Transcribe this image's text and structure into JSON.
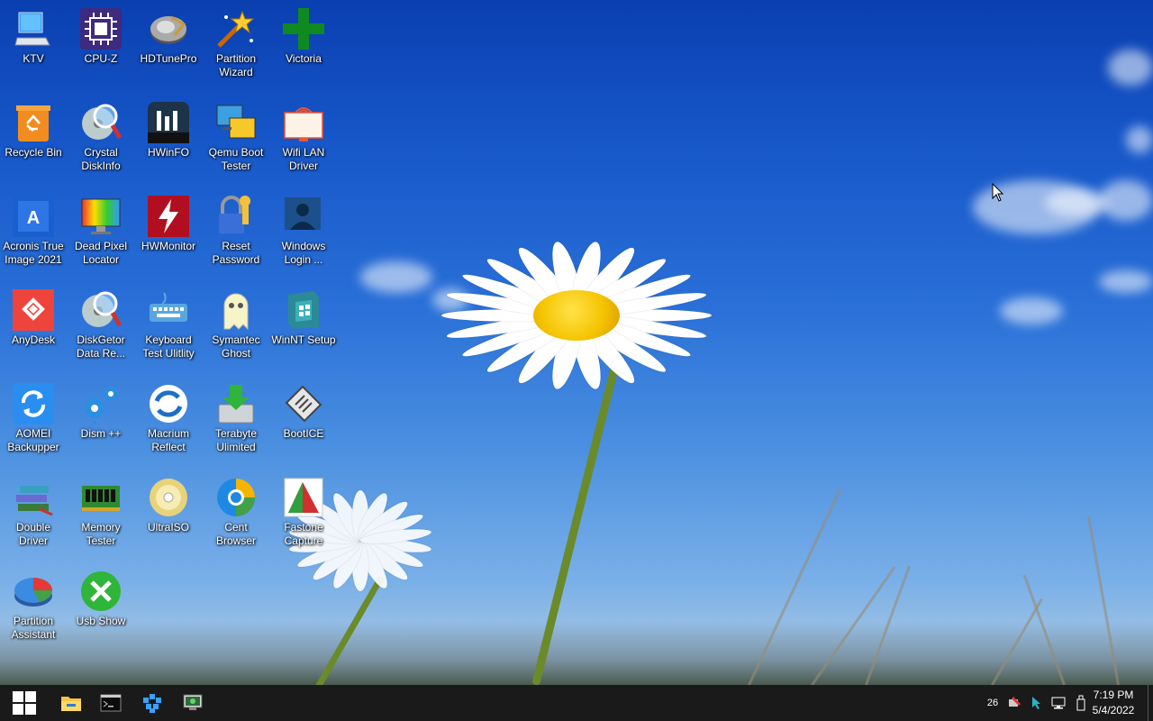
{
  "desktop_icons": [
    {
      "name": "ktv",
      "label": "KTV",
      "icon": "computer-icon"
    },
    {
      "name": "cpu-z",
      "label": "CPU-Z",
      "icon": "cpu-chip-icon"
    },
    {
      "name": "hdtunepro",
      "label": "HDTunePro",
      "icon": "hard-drive-icon"
    },
    {
      "name": "partition-wizard",
      "label": "Partition Wizard",
      "icon": "magic-wand-icon"
    },
    {
      "name": "victoria",
      "label": "Victoria",
      "icon": "green-cross-icon"
    },
    {
      "name": "recycle-bin",
      "label": "Recycle Bin",
      "icon": "recycle-bin-icon"
    },
    {
      "name": "crystal-diskinfo",
      "label": "Crystal DiskInfo",
      "icon": "disk-magnifier-icon"
    },
    {
      "name": "hwinfo",
      "label": "HWinFO",
      "icon": "hwinfo-icon"
    },
    {
      "name": "qemu-boot-tester",
      "label": "Qemu Boot Tester",
      "icon": "monitors-icon"
    },
    {
      "name": "wifi-lan-driver",
      "label": "Wifi LAN Driver",
      "icon": "wifi-monitor-icon"
    },
    {
      "name": "acronis",
      "label": "Acronis True Image 2021",
      "icon": "acronis-icon"
    },
    {
      "name": "dead-pixel-locator",
      "label": "Dead Pixel Locator",
      "icon": "color-monitor-icon"
    },
    {
      "name": "hwmonitor",
      "label": "HWMonitor",
      "icon": "lightning-icon"
    },
    {
      "name": "reset-password",
      "label": "Reset Password",
      "icon": "lock-key-icon"
    },
    {
      "name": "windows-login",
      "label": "Windows Login ...",
      "icon": "user-monitor-icon"
    },
    {
      "name": "anydesk",
      "label": "AnyDesk",
      "icon": "anydesk-icon"
    },
    {
      "name": "diskgetor",
      "label": "DiskGetor Data Re...",
      "icon": "disk-magnifier-icon"
    },
    {
      "name": "keyboard-test",
      "label": "Keyboard Test Ulitlity",
      "icon": "keyboard-icon"
    },
    {
      "name": "symantec-ghost",
      "label": "Symantec Ghost",
      "icon": "ghost-icon"
    },
    {
      "name": "winnt-setup",
      "label": "WinNT Setup",
      "icon": "windows-box-icon"
    },
    {
      "name": "aomei-backupper",
      "label": "AOMEI Backupper",
      "icon": "sync-icon"
    },
    {
      "name": "dism",
      "label": "Dism ++",
      "icon": "gears-icon"
    },
    {
      "name": "macrium-reflect",
      "label": "Macrium Reflect",
      "icon": "macrium-icon"
    },
    {
      "name": "terabyte",
      "label": "Terabyte Ulimited",
      "icon": "download-drive-icon"
    },
    {
      "name": "bootice",
      "label": "BootICE",
      "icon": "floppy-icon"
    },
    {
      "name": "double-driver",
      "label": "Double Driver",
      "icon": "books-icon"
    },
    {
      "name": "memory-tester",
      "label": "Memory Tester",
      "icon": "ram-icon"
    },
    {
      "name": "ultraiso",
      "label": "UltraISO",
      "icon": "cd-icon"
    },
    {
      "name": "cent-browser",
      "label": "Cent Browser",
      "icon": "browser-icon"
    },
    {
      "name": "fastone-capture",
      "label": "Fastone Capture",
      "icon": "fastone-icon"
    },
    {
      "name": "partition-assistant",
      "label": "Partition Assistant",
      "icon": "pie-disk-icon"
    },
    {
      "name": "usb-show",
      "label": "Usb Show",
      "icon": "tools-icon"
    }
  ],
  "taskbar": {
    "pinned": [
      {
        "name": "start-button",
        "icon": "windows-logo-icon"
      },
      {
        "name": "file-explorer-button",
        "icon": "folder-icon"
      },
      {
        "name": "command-prompt-button",
        "icon": "terminal-icon"
      },
      {
        "name": "cubes-app-button",
        "icon": "cubes-icon"
      },
      {
        "name": "monitor-app-button",
        "icon": "monitor-app-icon"
      }
    ],
    "tray": {
      "badge_count": "26",
      "icons": [
        "network-tool-icon",
        "cursor-tray-icon",
        "network-icon",
        "usb-eject-icon"
      ]
    },
    "clock": {
      "time": "7:19 PM",
      "date": "5/4/2022"
    }
  }
}
